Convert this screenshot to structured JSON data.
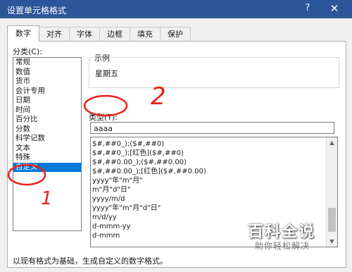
{
  "window": {
    "title": "设置单元格格式",
    "help_icon": "?",
    "close_icon": "✕"
  },
  "tabs": [
    "数字",
    "对齐",
    "字体",
    "边框",
    "填充",
    "保护"
  ],
  "category": {
    "label": "分类(C):",
    "items": [
      "常规",
      "数值",
      "货币",
      "会计专用",
      "日期",
      "时间",
      "百分比",
      "分数",
      "科学记数",
      "文本",
      "特殊",
      "自定义"
    ],
    "selected_index": 11
  },
  "sample": {
    "legend": "示例",
    "value": "星期五"
  },
  "type": {
    "label": "类型(T):",
    "value": "aaaa",
    "formats": [
      "$#,##0_);($#,##0)",
      "$#,##0_);[红色]($#,##0)",
      "$#,##0.00_);($#,##0.00)",
      "$#,##0.00_);[红色]($#,##0.00)",
      "yyyy\"年\"m\"月\"",
      "m\"月\"d\"日\"",
      "yyyy/m/d",
      "yyyy\"年\"m\"月\"d\"日\"",
      "m/d/yy",
      "d-mmm-yy",
      "d-mmm"
    ]
  },
  "footer": "以现有格式为基础，生成自定义的数字格式。",
  "annotations": {
    "one": "1",
    "two": "2",
    "color": "#e8221a"
  },
  "watermark": {
    "brand": "百科全说",
    "slogan": "助你轻松解决"
  }
}
